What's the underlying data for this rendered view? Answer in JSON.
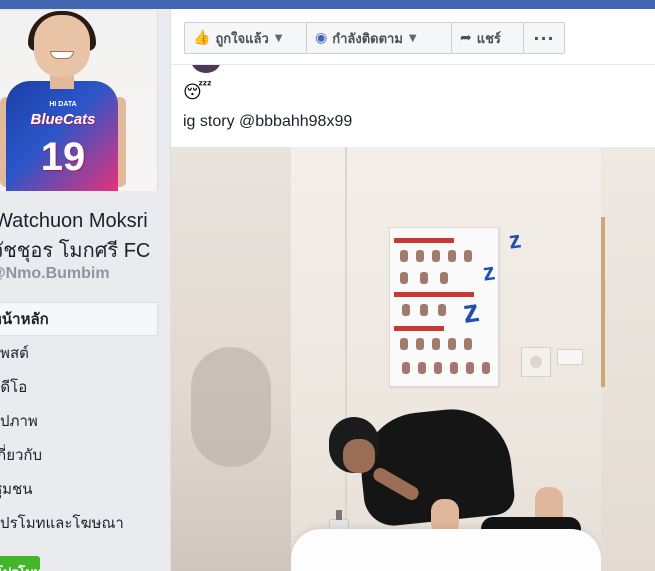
{
  "page": {
    "name_line1": "Watchuon Moksri",
    "name_line2": "วัชชุอร โมกศรี FC",
    "handle": "@Nmo.Bumbim"
  },
  "profile_picture": {
    "jersey_top": "HI DATA",
    "team_name": "BlueCats",
    "jersey_number": "19"
  },
  "left_menu": {
    "items": [
      {
        "label": "หน้าหลัก",
        "active": true
      },
      {
        "label": "โพสต์"
      },
      {
        "label": "วิดีโอ"
      },
      {
        "label": "รูปภาพ"
      },
      {
        "label": "เกี่ยวกับ"
      },
      {
        "label": "ชุมชน"
      },
      {
        "label": "โปรโมทและโฆษณา"
      }
    ],
    "cta_label": "โปรโมท"
  },
  "actions": {
    "like_label": "ถูกใจแล้ว",
    "follow_label": "กำลังติดตาม",
    "share_label": "แชร์",
    "more_label": "···"
  },
  "post": {
    "emoji": "😴",
    "caption": "ig story @bbbahh98x99",
    "story_stickers": [
      "z",
      "z",
      "z"
    ]
  },
  "colors": {
    "facebook_blue": "#4267b2",
    "cta_green": "#42b72a",
    "sticker_blue": "#1f4fb3"
  }
}
